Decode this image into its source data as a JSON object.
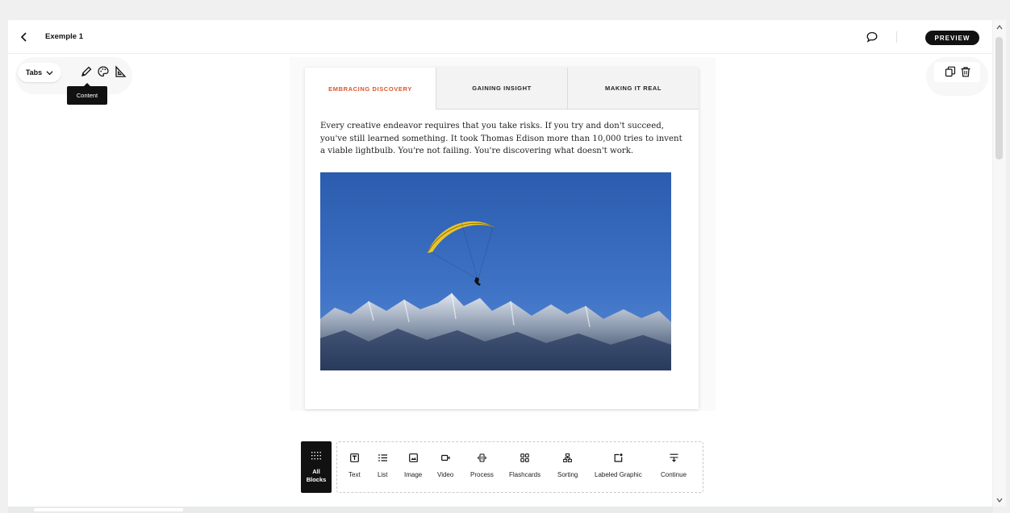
{
  "header": {
    "title": "Exemple 1",
    "preview_label": "PREVIEW"
  },
  "toolbar": {
    "block_type": "Tabs",
    "tooltip": "Content",
    "icons": [
      "pencil-icon",
      "palette-icon",
      "ruler-triangle-icon"
    ]
  },
  "block_actions": {
    "icons": [
      "duplicate-icon",
      "trash-icon"
    ]
  },
  "tabs": [
    {
      "label": "EMBRACING DISCOVERY",
      "active": true
    },
    {
      "label": "GAINING INSIGHT",
      "active": false
    },
    {
      "label": "MAKING IT REAL",
      "active": false
    }
  ],
  "content": {
    "text": "Every creative endeavor requires that you take risks. If you try and don't succeed, you've still learned something. It took Thomas Edison more than 10,000 tries to invent a viable lightbulb. You're not failing. You're discovering what doesn't work.",
    "image": "paraglider over snowy mountain range against blue sky"
  },
  "block_menu": {
    "all_blocks_line1": "All",
    "all_blocks_line2": "Blocks",
    "items": [
      {
        "label": "Text",
        "icon": "text-icon"
      },
      {
        "label": "List",
        "icon": "list-icon"
      },
      {
        "label": "Image",
        "icon": "image-icon"
      },
      {
        "label": "Video",
        "icon": "video-icon"
      },
      {
        "label": "Process",
        "icon": "process-icon"
      },
      {
        "label": "Flashcards",
        "icon": "flashcards-icon"
      },
      {
        "label": "Sorting",
        "icon": "sorting-icon"
      },
      {
        "label": "Labeled Graphic",
        "icon": "labeled-graphic-icon"
      },
      {
        "label": "Continue",
        "icon": "continue-icon"
      }
    ]
  },
  "colors": {
    "accent": "#e0542a",
    "dark": "#111111",
    "sky": "#2f63b4"
  }
}
